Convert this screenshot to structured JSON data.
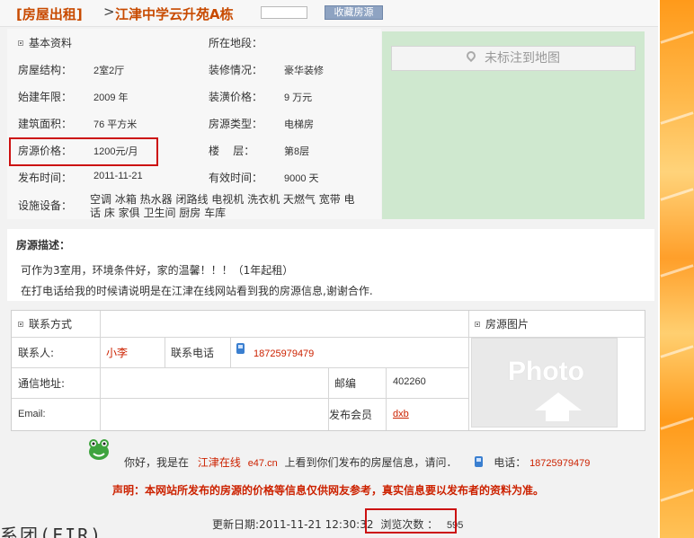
{
  "header": {
    "category": "[房屋出租]",
    "separator": ">",
    "title": "江津中学云升苑A栋",
    "favorite_button": "收藏房源"
  },
  "info": {
    "section_title": "基本资料",
    "location_label": "所在地段：",
    "location_value": "",
    "structure_label": "房屋结构：",
    "structure_value": "2室2厅",
    "decoration_label": "装修情况：",
    "decoration_value": "豪华装修",
    "year_label": "始建年限：",
    "year_value": "2009 年",
    "deco_price_label": "装潢价格：",
    "deco_price_value": "9 万元",
    "area_label": "建筑面积：",
    "area_value": "76 平方米",
    "type_label": "房源类型：",
    "type_value": "电梯房",
    "price_label": "房源价格：",
    "price_value": "1200元/月",
    "floor_label": "楼    层：",
    "floor_value": "第8层",
    "publish_label": "发布时间：",
    "publish_value": "2011-11-21",
    "valid_label": "有效时间：",
    "valid_value": "9000 天",
    "facility_label": "设施设备：",
    "facility_line1": "空调 冰箱 热水器 闭路线 电视机 洗衣机 天燃气 宽带 电",
    "facility_line2": "话 床 家俱 卫生间 厨房 车库"
  },
  "map": {
    "button": "未标注到地图"
  },
  "description": {
    "title": "房源描述：",
    "line1": "可作为3室用，环境条件好，家的温馨！！！（1年起租）",
    "line2": "在打电话给我的时候请说明是在江津在线网站看到我的房源信息,谢谢合作."
  },
  "contact": {
    "section_title": "联系方式",
    "photo_title": "房源图片",
    "contact_label": "联系人:",
    "contact_value": "小李",
    "phone_label": "联系电话",
    "phone_value": "18725979479",
    "address_label": "通信地址:",
    "address_value": "",
    "zip_label": "邮编",
    "zip_value": "402260",
    "email_label": "Email:",
    "email_value": "",
    "member_label": "发布会员",
    "member_value": "dxb",
    "photo_placeholder": "Photo"
  },
  "footer": {
    "say_prefix": "你好，我是在",
    "site_name": "江津在线",
    "site_domain": "e47.cn",
    "say_suffix": "上看到你们发布的房屋信息，请问．",
    "tel_label": "电话：",
    "tel_value": "18725979479",
    "notice": "声明：本网站所发布的房源的价格等信息仅供网友参考，真实信息要以发布者的资料为准。",
    "update_label": "更新日期:2011-11-21 12:30:32",
    "views_label": "浏览次数 ：",
    "views_value": "595",
    "logo_fragment": "系团(FIR)"
  }
}
